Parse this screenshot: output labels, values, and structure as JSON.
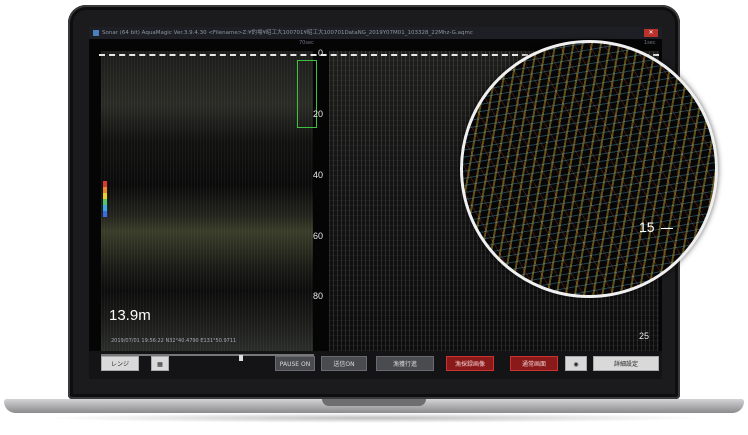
{
  "window": {
    "title": "Sonar (64 bit) AquaMagic Ver.3.9.4.30 <Filename>Z:¥釣場¥昭工大100701¥昭工大100701DataNG_2019Y07M01_103328_22Mhz-G.aqmc",
    "close_label": "✕"
  },
  "panel_labels": {
    "left": "70sec",
    "right": "1sec"
  },
  "left_display": {
    "depth_readout": "13.9m",
    "coordinates": "2019/07/01 19:56:22 N32°40.4790 E131°50.9711",
    "depth_ticks": [
      "0",
      "20",
      "40",
      "60",
      "80"
    ],
    "color_scale": [
      "#d93a2b",
      "#e8882c",
      "#e8d12c",
      "#52c66b",
      "#3aa8e8",
      "#3a6be8"
    ]
  },
  "right_display": {
    "depth_ticks": [
      "25"
    ],
    "magnifier_label": "15"
  },
  "toolbar": {
    "range_label": "レンジ",
    "pause_label": "PAUSE ON",
    "send_label": "送信ON",
    "manual_mode_label": "漁獲行進",
    "record_screen_label": "漁採録画像",
    "normal_screen_label": "通常画面",
    "camera_icon": "camera-icon",
    "detail_settings_label": "詳細設定"
  },
  "colors": {
    "accent_red": "#8a1a1a",
    "selection_green": "#3fbf3f"
  }
}
